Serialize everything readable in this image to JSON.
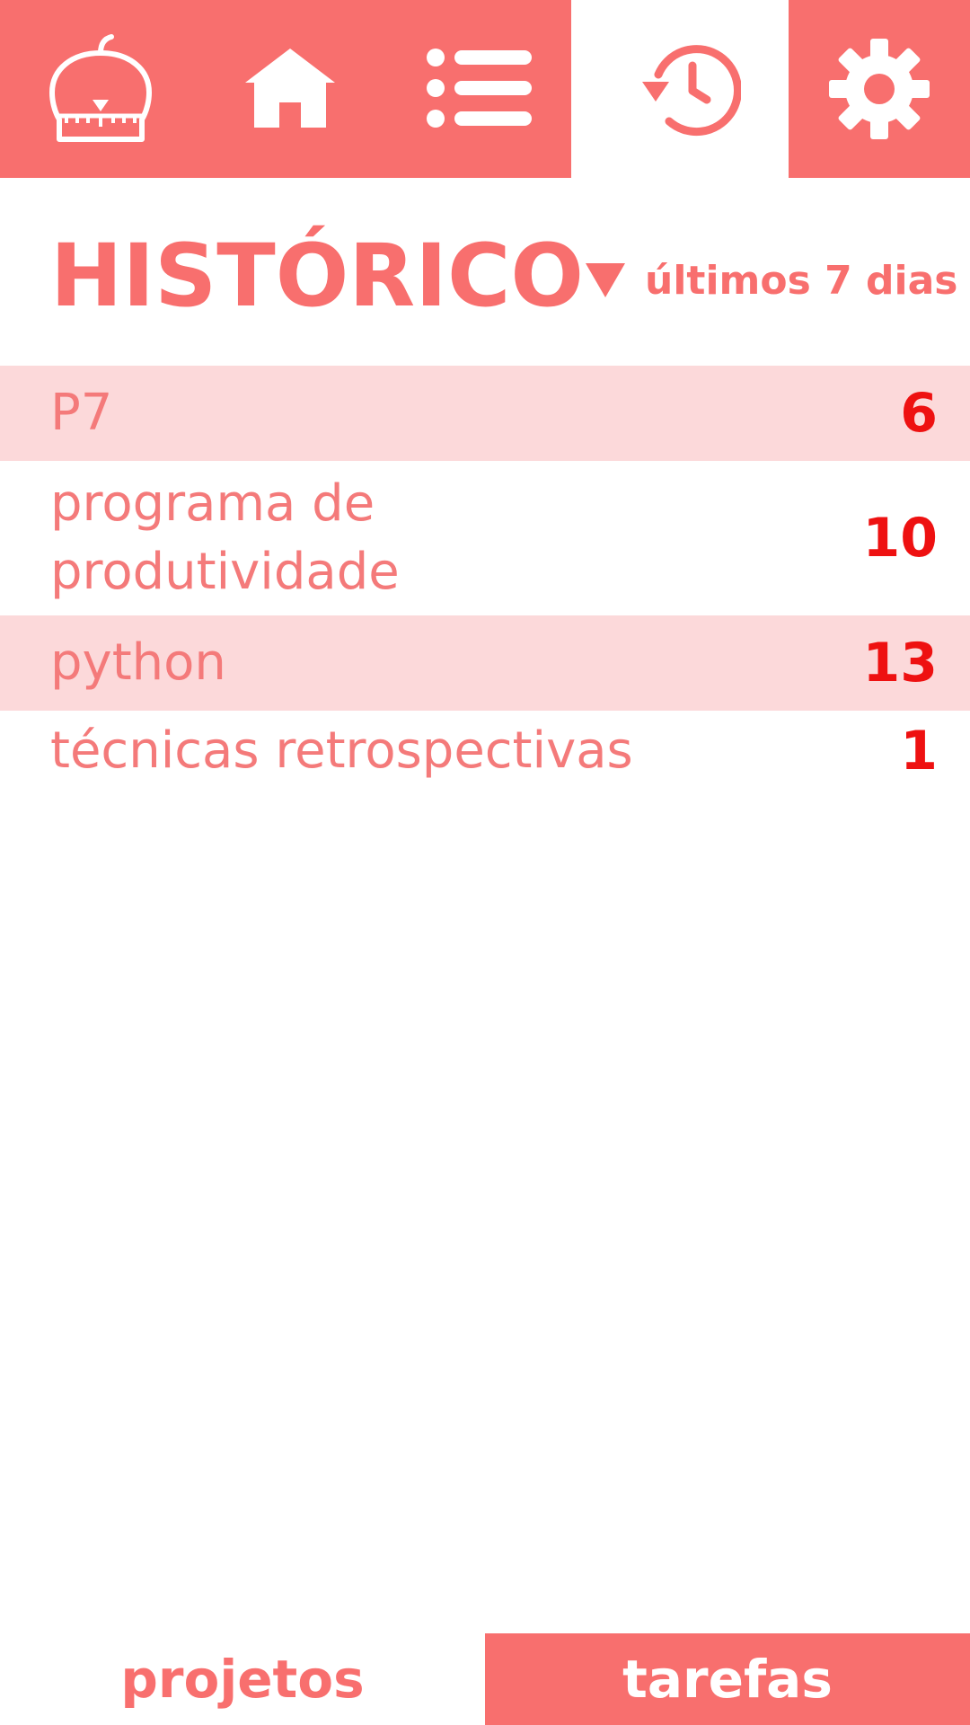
{
  "colors": {
    "accent": "#f86f6e",
    "row_highlight": "#fcd9da",
    "count": "#ee1111",
    "row_text": "#f47a7a"
  },
  "nav": {
    "icons": [
      "pomodoro-logo-icon",
      "home-icon",
      "list-icon",
      "history-icon",
      "gear-icon"
    ],
    "active": "history"
  },
  "header": {
    "title": "HISTÓRICO",
    "filter_label": "últimos 7 dias"
  },
  "history": {
    "items": [
      {
        "name": "P7",
        "count": "6"
      },
      {
        "name": "programa de produtividade",
        "count": "10"
      },
      {
        "name": "python",
        "count": "13"
      },
      {
        "name": "técnicas retrospectivas",
        "count": "1"
      }
    ]
  },
  "tabs": {
    "projects": "projetos",
    "tasks": "tarefas"
  }
}
